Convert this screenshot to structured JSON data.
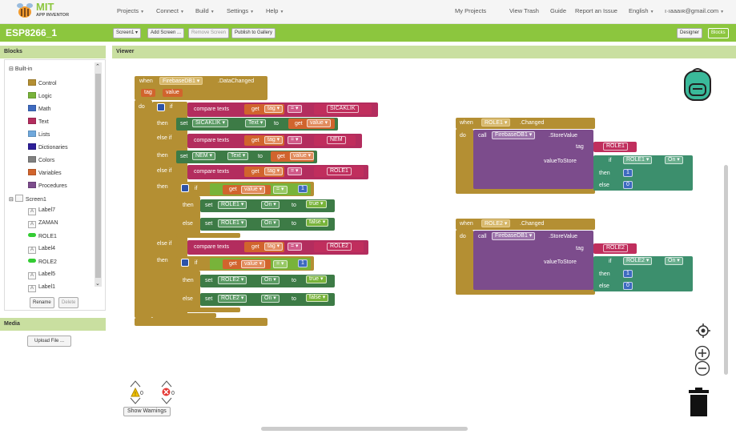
{
  "app": {
    "logo_text": "MIT",
    "logo_sub": "APP INVENTOR"
  },
  "topmenu": [
    "Projects",
    "Connect",
    "Build",
    "Settings",
    "Help"
  ],
  "topright": [
    "My Projects",
    "View Trash",
    "Guide",
    "Report an Issue",
    "English"
  ],
  "account": "ı·ıaaaıʀ@gmail.com",
  "project": {
    "name": "ESP8266_1",
    "screen_select": "Screen1",
    "add_screen": "Add Screen ...",
    "remove_screen": "Remove Screen",
    "publish": "Publish to Gallery",
    "designer": "Designer",
    "blocks": "Blocks"
  },
  "blocks_panel": {
    "title": "Blocks",
    "builtin": "Built-in",
    "categories": [
      {
        "label": "Control",
        "color": "#b48f33"
      },
      {
        "label": "Logic",
        "color": "#78b33a"
      },
      {
        "label": "Math",
        "color": "#3e6ac0"
      },
      {
        "label": "Text",
        "color": "#b32d5e"
      },
      {
        "label": "Lists",
        "color": "#6fa8dc"
      },
      {
        "label": "Dictionaries",
        "color": "#2d1f99"
      },
      {
        "label": "Colors",
        "color": "#808080"
      },
      {
        "label": "Variables",
        "color": "#d1642d"
      },
      {
        "label": "Procedures",
        "color": "#7c4c8c"
      }
    ],
    "screen": "Screen1",
    "components": [
      "Label7",
      "ZAMAN",
      "ROLE1",
      "Label4",
      "ROLE2",
      "Label5",
      "Label1"
    ],
    "rename": "Rename",
    "delete": "Delete"
  },
  "media": {
    "title": "Media",
    "upload": "Upload File ..."
  },
  "viewer": {
    "title": "Viewer",
    "warnings_count": "0",
    "errors_count": "0",
    "show_warnings": "Show Warnings"
  },
  "ev1": {
    "when": "when",
    "component": "FirebaseDB1",
    "event": ".DataChanged",
    "param1": "tag",
    "param2": "value",
    "do": "do",
    "if": "if",
    "compare": "compare texts",
    "get": "get",
    "eq": "=",
    "then": "then",
    "elseif": "else if",
    "else": "else",
    "set": "set",
    "to": "to",
    "s1": "SICAKLIK",
    "sicaklik": "SICAKLIK",
    "prop_text": "Text",
    "s2": "NEM",
    "nem": "NEM",
    "s3": "ROLE1",
    "role1": "ROLE1",
    "prop_on": "On",
    "one": "1",
    "true": "true",
    "false": "false",
    "s4": "ROLE2",
    "role2": "ROLE2"
  },
  "ev2": {
    "when": "when",
    "component": "ROLE1",
    "event": ".Changed",
    "do": "do",
    "call": "call",
    "db": "FirebaseDB1",
    "method": ".StoreValue",
    "tag": "tag",
    "vts": "valueToStore",
    "tagval": "ROLE1",
    "if": "if",
    "then": "then",
    "else": "else",
    "comp": "ROLE1",
    "prop": "On",
    "one": "1",
    "zero": "0"
  },
  "ev3": {
    "when": "when",
    "component": "ROLE2",
    "event": ".Changed",
    "do": "do",
    "call": "call",
    "db": "FirebaseDB1",
    "method": ".StoreValue",
    "tag": "tag",
    "vts": "valueToStore",
    "tagval": "ROLE2",
    "if": "if",
    "then": "then",
    "else": "else",
    "comp": "ROLE2",
    "prop": "On",
    "one": "1",
    "zero": "0"
  }
}
